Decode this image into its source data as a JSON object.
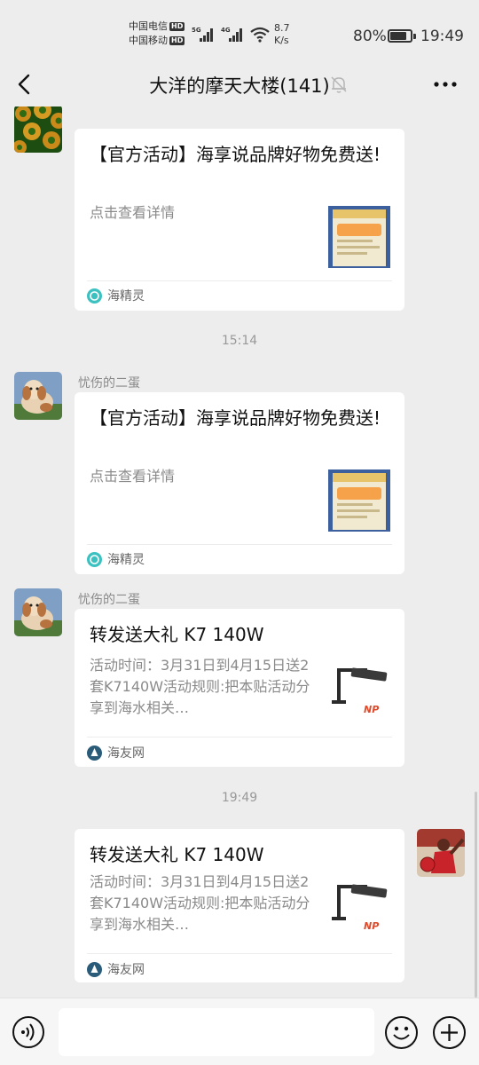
{
  "status_bar": {
    "carrier_1": "中国电信",
    "carrier_2": "中国移动",
    "hd_badge": "HD",
    "net_5g": "5G",
    "net_4g": "4G",
    "speed_value": "8.7",
    "speed_unit": "K/s",
    "battery_percent": "80%",
    "battery_level": 0.8,
    "time": "19:49"
  },
  "header": {
    "title": "大洋的摩天大楼(141)",
    "back_icon": "chevron-left-icon",
    "mute_icon": "bell-off-icon",
    "more_icon": "more-dots-icon"
  },
  "messages": [
    {
      "type": "link-card",
      "side": "left",
      "avatar": "green-coral-avatar",
      "title": "【官方活动】海享说品牌好物免费送!",
      "description": "点击查看详情",
      "source": "海精灵"
    },
    {
      "type": "timestamp",
      "text": "15:14"
    },
    {
      "type": "link-card",
      "side": "left",
      "nickname": "忧伤的二蛋",
      "avatar": "dog-avatar",
      "title": "【官方活动】海享说品牌好物免费送!",
      "description": "点击查看详情",
      "source": "海精灵"
    },
    {
      "type": "link-card",
      "side": "left",
      "nickname": "忧伤的二蛋",
      "avatar": "dog-avatar",
      "title": "转发送大礼 K7 140W",
      "description": "活动时间：3月31日到4月15日送2套K7140W活动规则:把本贴活动分享到海水相关…",
      "source": "海友网",
      "thumb_caption": "NP"
    },
    {
      "type": "timestamp",
      "text": "19:49"
    },
    {
      "type": "link-card",
      "side": "right",
      "avatar": "basketball-player-avatar",
      "title": "转发送大礼 K7 140W",
      "description": "活动时间：3月31日到4月15日送2套K7140W活动规则:把本贴活动分享到海水相关…",
      "source": "海友网",
      "thumb_caption": "NP"
    }
  ],
  "input_bar": {
    "voice_icon": "voice-icon",
    "emoji_icon": "emoji-icon",
    "plus_icon": "plus-circle-icon",
    "input_value": ""
  },
  "colors": {
    "background": "#ededed",
    "card": "#ffffff",
    "muted_text": "#8a8a8a",
    "source_icon_teal": "#3cc1c1",
    "source_icon_dark": "#2a5c7a"
  }
}
